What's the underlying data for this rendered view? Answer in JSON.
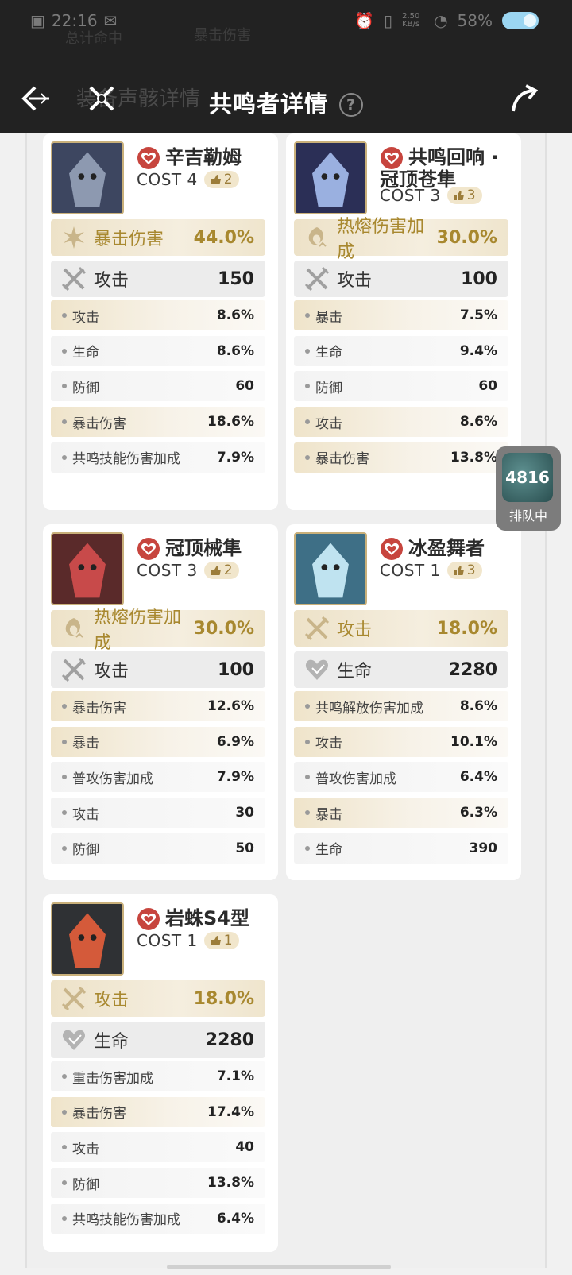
{
  "status_bar": {
    "time": "22:16",
    "network_speed": "2.50 KB/s",
    "battery": "58%"
  },
  "behind_text": {
    "left": "总计命中",
    "right": "暴击伤害",
    "subtitle": "装备声骸详情"
  },
  "header": {
    "title": "共鸣者详情",
    "help_label": "?"
  },
  "floating_widget": {
    "count": "4816",
    "status": "排队中"
  },
  "colors": {
    "accent_gold": "#a8882f",
    "header_bg": "#222222",
    "highlight_bg": "#efe4ca"
  },
  "cards": [
    {
      "name": "辛吉勒姆",
      "cost": "COST 4",
      "level": "2",
      "main": {
        "icon": "crit-damage-icon",
        "label": "暴击伤害",
        "value": "44.0%"
      },
      "secondary": {
        "icon": "attack-icon",
        "label": "攻击",
        "value": "150"
      },
      "subs": [
        {
          "label": "攻击",
          "value": "8.6%"
        },
        {
          "label": "生命",
          "value": "8.6%"
        },
        {
          "label": "防御",
          "value": "60"
        },
        {
          "label": "暴击伤害",
          "value": "18.6%"
        },
        {
          "label": "共鸣技能伤害加成",
          "value": "7.9%"
        }
      ]
    },
    {
      "name": "共鸣回响 · 冠顶苍隼",
      "name_line1": "共鸣回响 ·",
      "name_line2": "冠顶苍隼",
      "cost": "COST 3",
      "level": "3",
      "main": {
        "icon": "fusion-damage-icon",
        "label": "热熔伤害加成",
        "value": "30.0%"
      },
      "secondary": {
        "icon": "attack-icon",
        "label": "攻击",
        "value": "100"
      },
      "subs": [
        {
          "label": "暴击",
          "value": "7.5%"
        },
        {
          "label": "生命",
          "value": "9.4%"
        },
        {
          "label": "防御",
          "value": "60"
        },
        {
          "label": "攻击",
          "value": "8.6%"
        },
        {
          "label": "暴击伤害",
          "value": "13.8%"
        }
      ]
    },
    {
      "name": "冠顶械隼",
      "cost": "COST 3",
      "level": "2",
      "main": {
        "icon": "fusion-damage-icon",
        "label": "热熔伤害加成",
        "value": "30.0%"
      },
      "secondary": {
        "icon": "attack-icon",
        "label": "攻击",
        "value": "100"
      },
      "subs": [
        {
          "label": "暴击伤害",
          "value": "12.6%"
        },
        {
          "label": "暴击",
          "value": "6.9%"
        },
        {
          "label": "普攻伤害加成",
          "value": "7.9%"
        },
        {
          "label": "攻击",
          "value": "30"
        },
        {
          "label": "防御",
          "value": "50"
        }
      ]
    },
    {
      "name": "冰盈舞者",
      "cost": "COST 1",
      "level": "3",
      "main": {
        "icon": "attack-icon",
        "label": "攻击",
        "value": "18.0%"
      },
      "secondary": {
        "icon": "health-icon",
        "label": "生命",
        "value": "2280"
      },
      "subs": [
        {
          "label": "共鸣解放伤害加成",
          "value": "8.6%"
        },
        {
          "label": "攻击",
          "value": "10.1%"
        },
        {
          "label": "普攻伤害加成",
          "value": "6.4%"
        },
        {
          "label": "暴击",
          "value": "6.3%"
        },
        {
          "label": "生命",
          "value": "390"
        }
      ]
    },
    {
      "name": "岩蛛S4型",
      "cost": "COST 1",
      "level": "1",
      "main": {
        "icon": "attack-icon",
        "label": "攻击",
        "value": "18.0%"
      },
      "secondary": {
        "icon": "health-icon",
        "label": "生命",
        "value": "2280"
      },
      "subs": [
        {
          "label": "重击伤害加成",
          "value": "7.1%"
        },
        {
          "label": "暴击伤害",
          "value": "17.4%"
        },
        {
          "label": "攻击",
          "value": "40"
        },
        {
          "label": "防御",
          "value": "13.8%"
        },
        {
          "label": "共鸣技能伤害加成",
          "value": "6.4%"
        }
      ]
    }
  ]
}
